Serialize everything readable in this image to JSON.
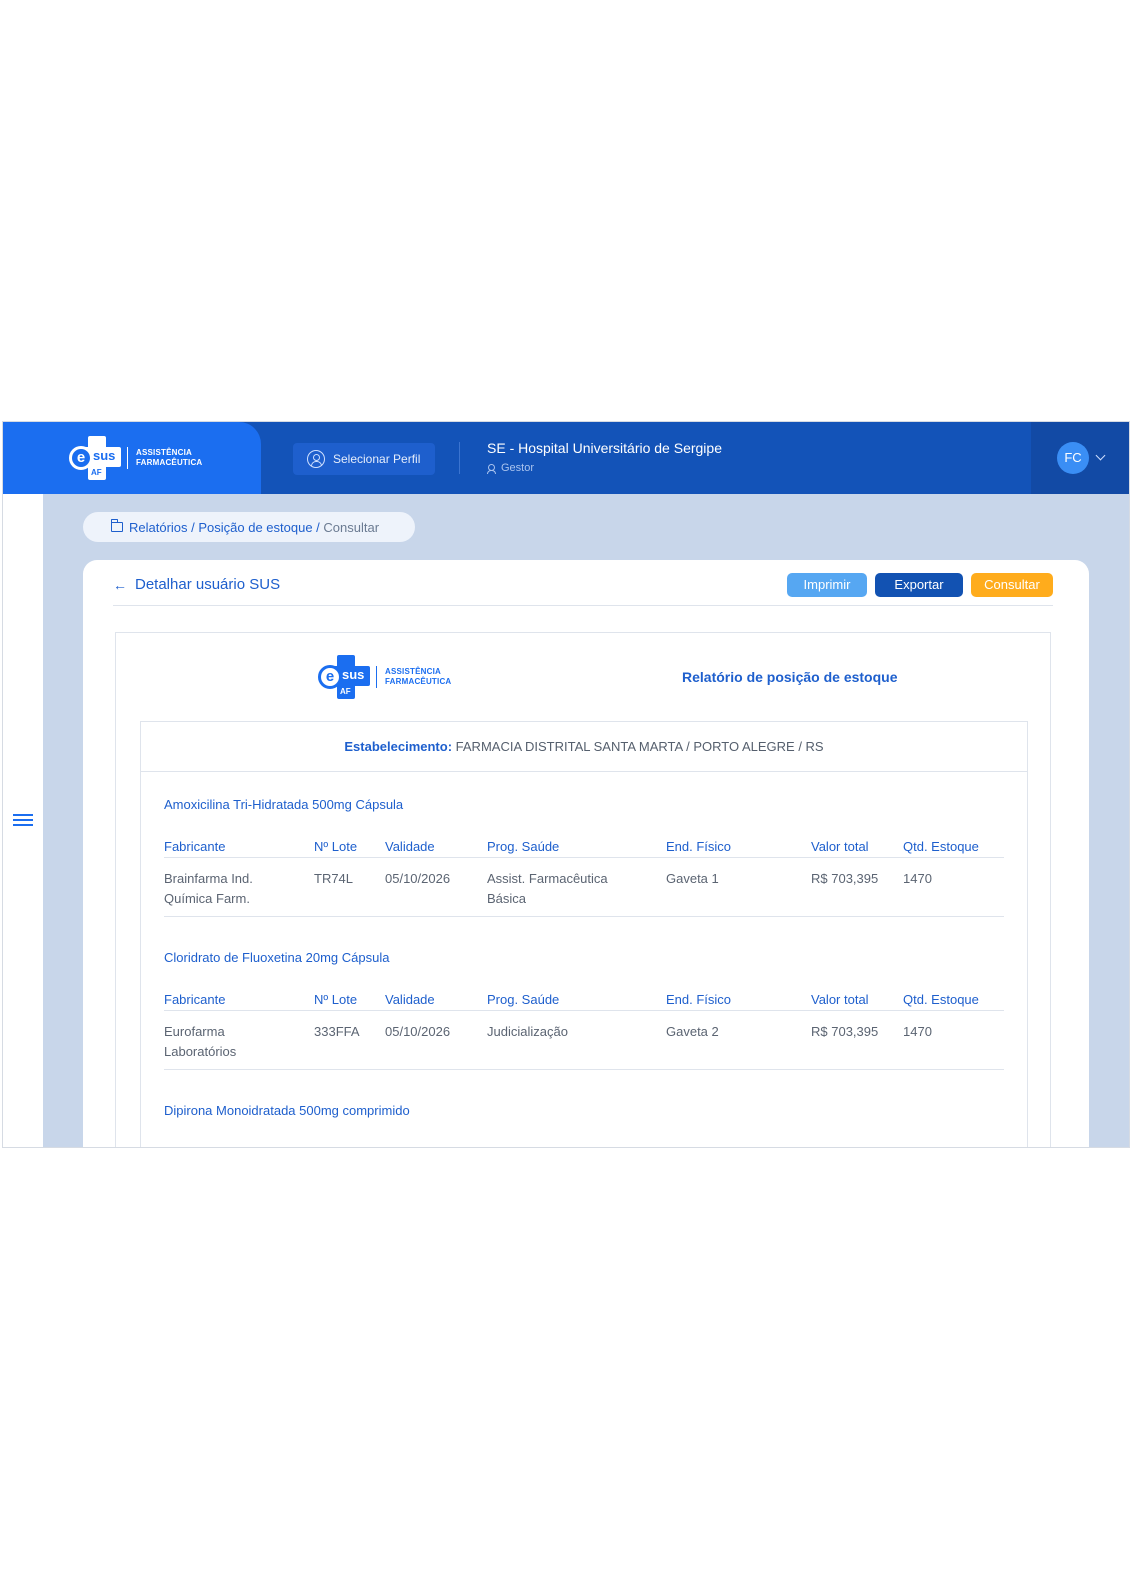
{
  "header": {
    "logo_text_line1": "ASSISTÊNCIA",
    "logo_text_line2": "FARMACÊUTICA",
    "logo_sus": "sus",
    "logo_af": "AF",
    "profile_button": "Selecionar Perfil",
    "hospital": "SE - Hospital Universitário de Sergipe",
    "role": "Gestor",
    "avatar_initials": "FC"
  },
  "breadcrumb": {
    "path": "Relatórios / Posição de estoque /",
    "current": "Consultar"
  },
  "toolbar": {
    "back_label": "Detalhar usuário SUS",
    "print_label": "Imprimir",
    "export_label": "Exportar",
    "query_label": "Consultar"
  },
  "report": {
    "title": "Relatório de posição de estoque",
    "estab_label": "Estabelecimento:",
    "estab_value": "FARMACIA DISTRITAL SANTA MARTA / PORTO ALEGRE / RS",
    "columns": [
      "Fabricante",
      "Nº Lote",
      "Validade",
      "Prog. Saúde",
      "End. Físico",
      "Valor total",
      "Qtd. Estoque"
    ],
    "products": [
      {
        "name": "Amoxicilina Tri-Hidratada 500mg Cápsula",
        "row": [
          "Brainfarma Ind. Química Farm.",
          "TR74L",
          "05/10/2026",
          "Assist. Farmacêutica Básica",
          "Gaveta 1",
          "R$ 703,395",
          "1470"
        ]
      },
      {
        "name": "Cloridrato de Fluoxetina 20mg Cápsula",
        "row": [
          "Eurofarma Laboratórios",
          "333FFA",
          "05/10/2026",
          "Judicialização",
          "Gaveta 2",
          "R$ 703,395",
          "1470"
        ]
      },
      {
        "name": "Dipirona Monoidratada 500mg comprimido"
      }
    ]
  },
  "colors": {
    "primary": "#1b6ef0",
    "topbar": "#1353b8",
    "print": "#56a7f2",
    "export": "#1252b2",
    "query": "#ffac1c",
    "background": "#c8d6ea"
  },
  "icons": {
    "profile": "user-circle-icon",
    "role": "person-icon",
    "menu": "hamburger-menu-icon",
    "breadcrumb": "folder-icon",
    "back": "arrow-left-icon",
    "user_menu": "chevron-down-icon"
  }
}
